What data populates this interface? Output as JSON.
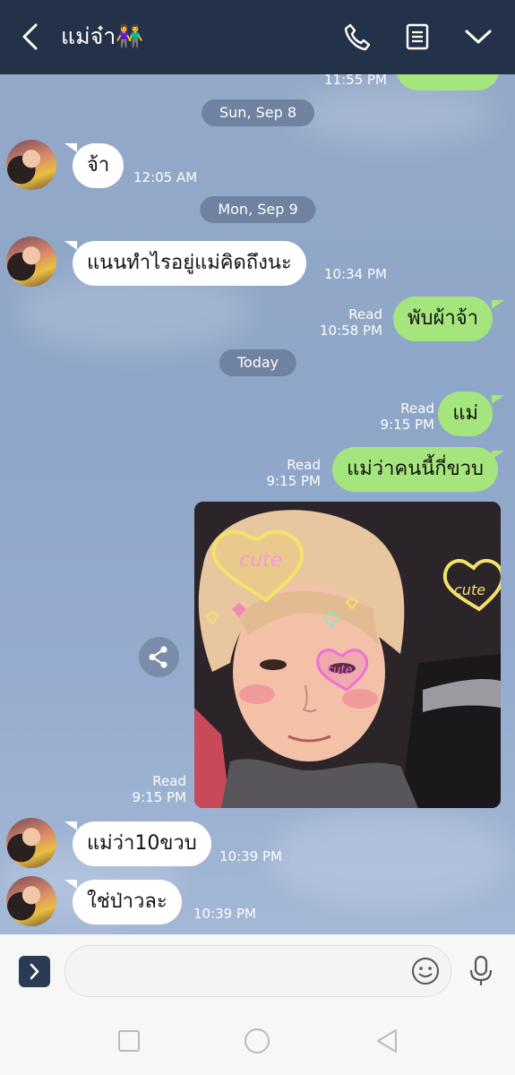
{
  "header": {
    "title": "แม่จ๋า👫",
    "back_icon": "chevron-left-icon",
    "call_icon": "phone-icon",
    "notes_icon": "notes-icon",
    "menu_icon": "chevron-down-icon"
  },
  "chat": {
    "top_time": "11:55 PM",
    "dates": [
      "Sun, Sep 8",
      "Mon, Sep 9",
      "Today"
    ],
    "messages": {
      "m1": {
        "text": "จ้า",
        "time": "12:05 AM"
      },
      "m2": {
        "text": "แนนทำไรอยู่แม่คิดถึงนะ",
        "time": "10:34 PM"
      },
      "m3": {
        "text": "พับผ้าจ้า",
        "status": "Read",
        "time": "10:58 PM"
      },
      "m4": {
        "text": "แม่",
        "status": "Read",
        "time": "9:15 PM"
      },
      "m5": {
        "text": "แม่ว่าคนนี้กี่ขวบ",
        "status": "Read",
        "time": "9:15 PM"
      },
      "m6": {
        "status": "Read",
        "time": "9:15 PM",
        "image_text": "cute"
      },
      "m7": {
        "text": "แม่ว่า10ขวบ",
        "time": "10:39 PM"
      },
      "m8": {
        "text": "ใช่ป่าวละ",
        "time": "10:39 PM"
      }
    }
  },
  "colors": {
    "header_bg": "#243249",
    "chat_bg": "#8ea7c9",
    "incoming_bubble": "#ffffff",
    "outgoing_bubble": "#a5e57d",
    "date_pill": "#6f82a0"
  },
  "input_bar": {
    "placeholder": "",
    "expand_icon": "chevron-right-icon",
    "emoji_icon": "smiley-icon",
    "mic_icon": "microphone-icon"
  },
  "system_nav": [
    "recent-apps-icon",
    "home-icon",
    "back-icon"
  ]
}
